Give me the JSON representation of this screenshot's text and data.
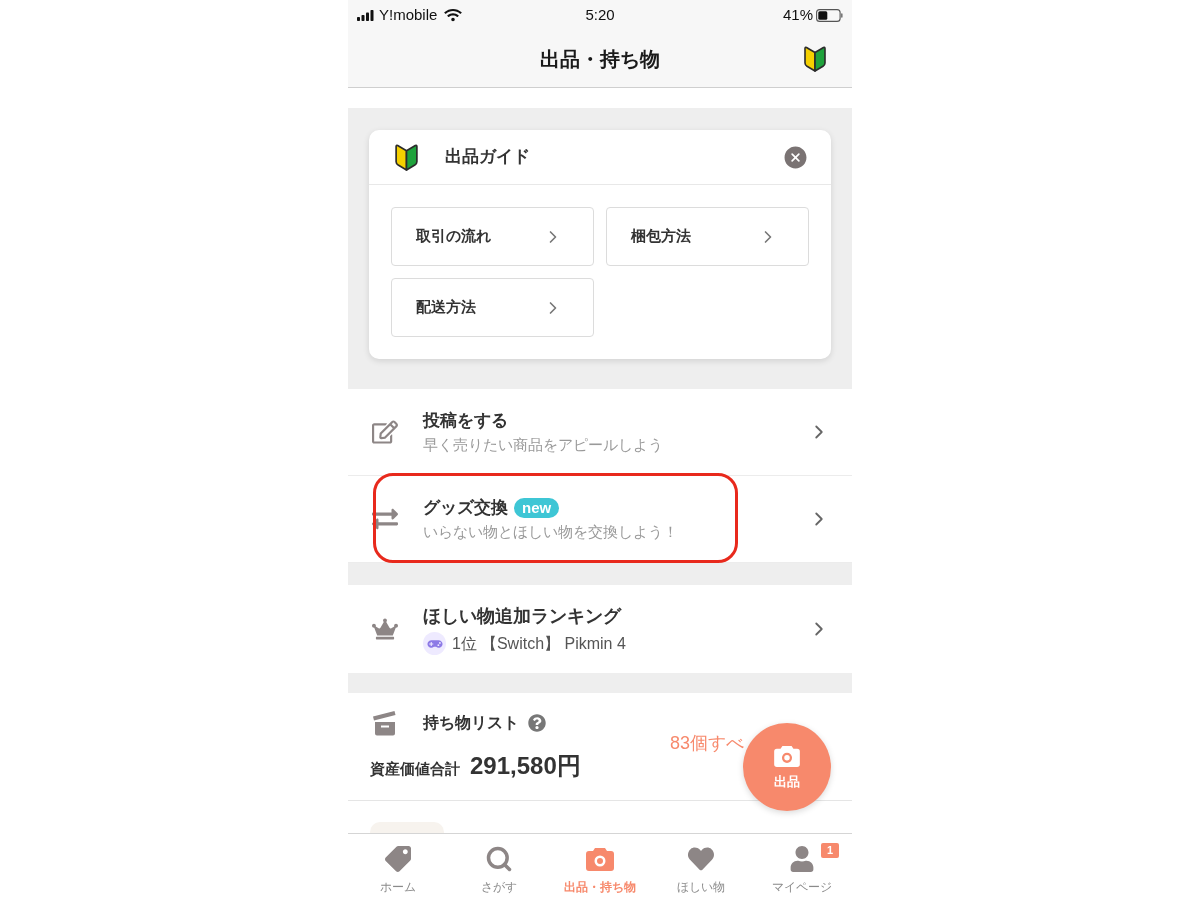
{
  "status_bar": {
    "carrier": "Y!mobile",
    "time": "5:20",
    "battery": "41%"
  },
  "header": {
    "title": "出品・持ち物"
  },
  "guide": {
    "title": "出品ガイド",
    "links": [
      "取引の流れ",
      "梱包方法",
      "配送方法"
    ]
  },
  "menu": [
    {
      "title": "投稿をする",
      "subtitle": "早く売りたい商品をアピールしよう",
      "highlighted": false
    },
    {
      "title": "グッズ交換",
      "badge": "new",
      "subtitle": "いらない物とほしい物を交換しよう！",
      "highlighted": true
    }
  ],
  "ranking": {
    "title": "ほしい物追加ランキング",
    "rank": "1位",
    "item": "【Switch】 Pikmin 4"
  },
  "belongings": {
    "title": "持ち物リスト",
    "total_label": "資産価値合計",
    "total_value": "291,580円",
    "count_link": "83個すべ"
  },
  "fab": {
    "label": "出品"
  },
  "tab_bar": [
    {
      "label": "ホーム",
      "selected": false
    },
    {
      "label": "さがす",
      "selected": false
    },
    {
      "label": "出品・持ち物",
      "selected": true
    },
    {
      "label": "ほしい物",
      "selected": false
    },
    {
      "label": "マイページ",
      "selected": false,
      "badge": "1"
    }
  ]
}
